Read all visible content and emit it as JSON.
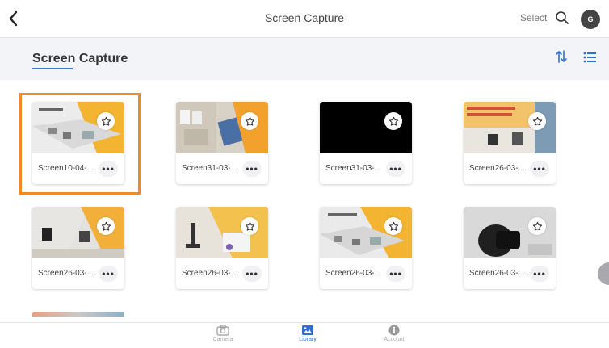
{
  "topbar": {
    "title": "Screen Capture",
    "select_label": "Select",
    "avatar_initial": "G"
  },
  "section": {
    "title": "Screen Capture"
  },
  "cards": [
    {
      "name": "Screen10-04-..."
    },
    {
      "name": "Screen31-03-..."
    },
    {
      "name": "Screen31-03-..."
    },
    {
      "name": "Screen26-03-..."
    },
    {
      "name": "Screen26-03-..."
    },
    {
      "name": "Screen26-03-..."
    },
    {
      "name": "Screen26-03-..."
    },
    {
      "name": "Screen26-03-..."
    }
  ],
  "more_label": "•••",
  "tabs": {
    "camera": "Camera",
    "library": "Library",
    "account": "Account"
  },
  "colors": {
    "accent": "#3a7bd5",
    "selection": "#f08a24"
  }
}
